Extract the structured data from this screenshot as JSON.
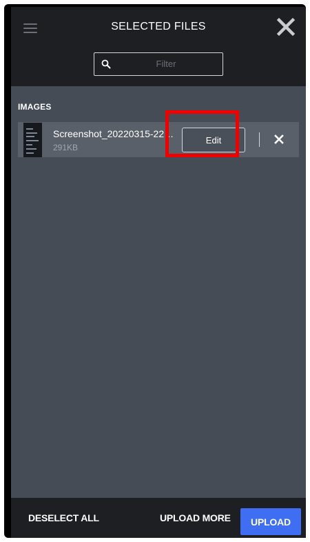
{
  "header": {
    "title": "SELECTED FILES",
    "menu_icon": "hamburger-menu-icon",
    "close_icon": "close-icon"
  },
  "filter": {
    "placeholder": "Filter",
    "value": "",
    "icon": "search-icon"
  },
  "sections": [
    {
      "label": "IMAGES",
      "files": [
        {
          "name": "Screenshot_20220315-2202...",
          "size": "291KB",
          "edit_label": "Edit",
          "remove_icon": "close-icon"
        }
      ]
    }
  ],
  "footer": {
    "deselect_label": "DESELECT ALL",
    "upload_more_label": "UPLOAD MORE",
    "upload_label": "UPLOAD"
  },
  "colors": {
    "header_bg": "#1d1f22",
    "body_bg": "#464c55",
    "row_bg": "#5a6069",
    "primary": "#3f6ef2",
    "highlight": "#f20000"
  }
}
